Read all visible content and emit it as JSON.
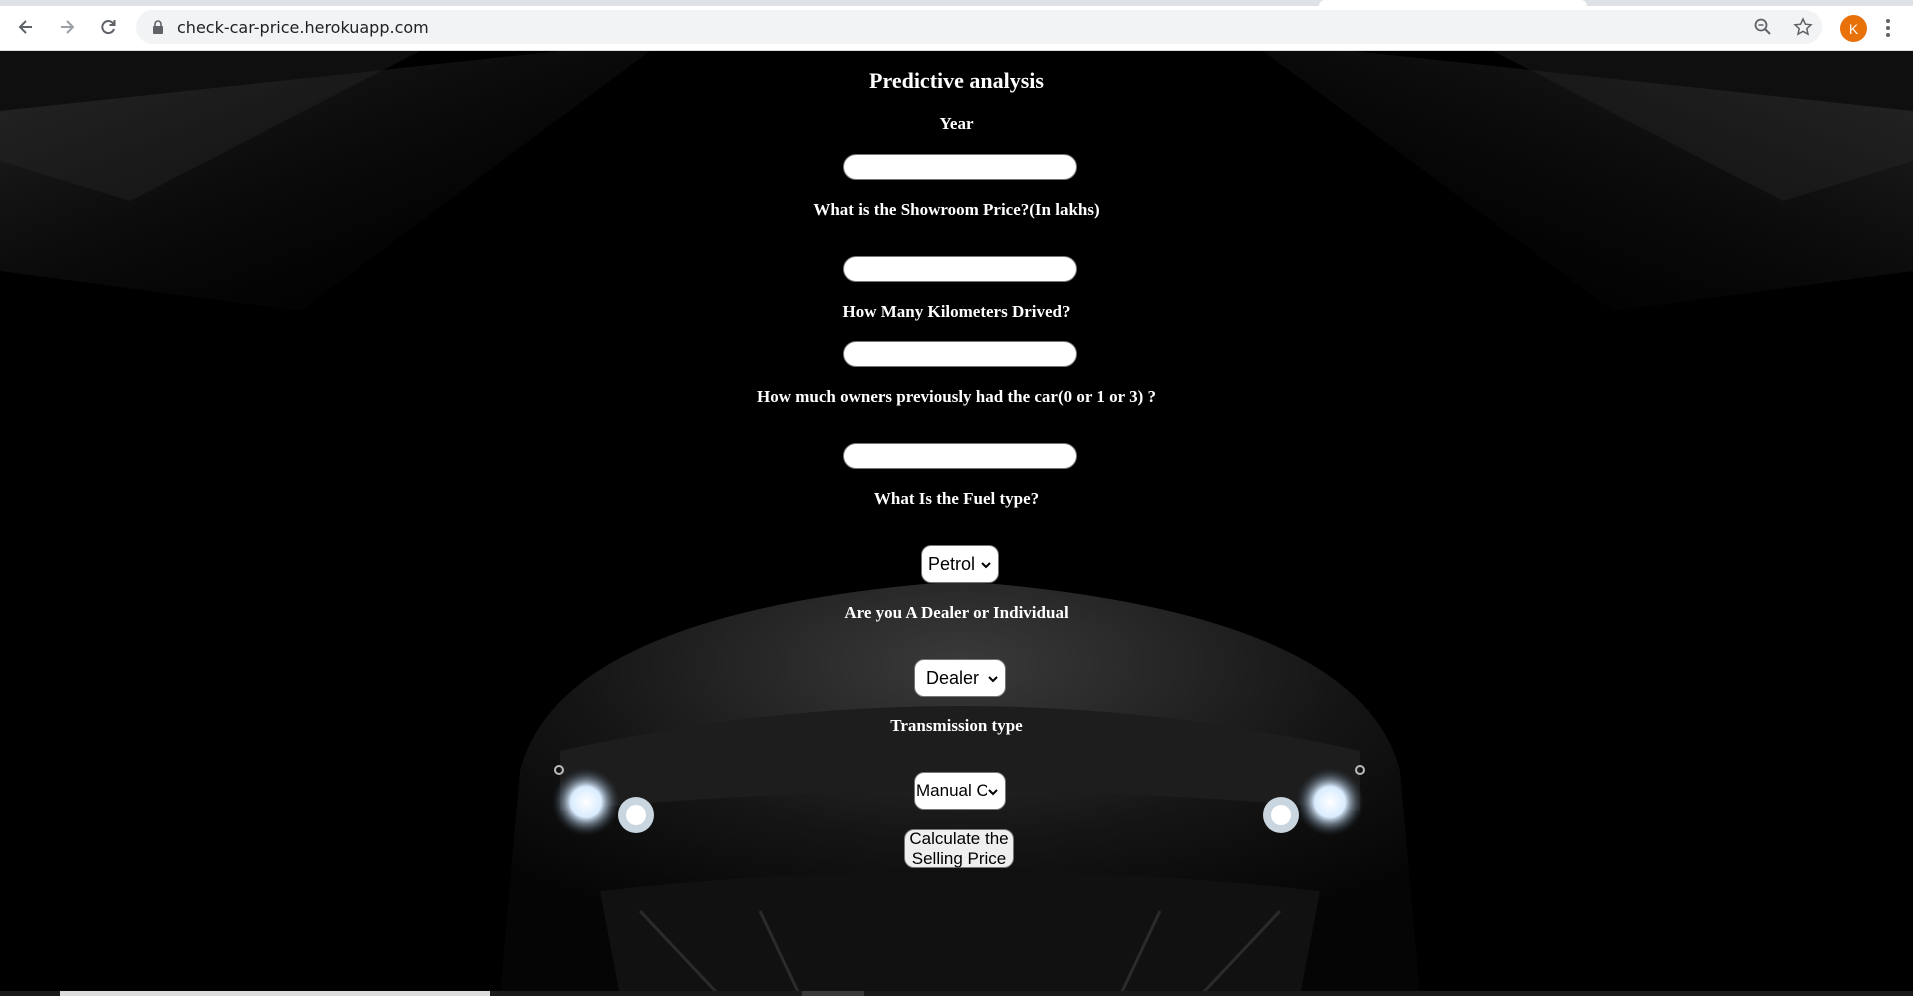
{
  "browser": {
    "url": "check-car-price.herokuapp.com",
    "profile_initial": "K",
    "icons": [
      "back-arrow-icon",
      "forward-arrow-icon",
      "reload-icon",
      "lock-icon",
      "zoom-icon",
      "star-icon",
      "kebab-menu-icon"
    ]
  },
  "form": {
    "title": "Predictive analysis",
    "year_label": "Year",
    "showroom_price_label": "What is the Showroom Price?(In lakhs)",
    "kms_label": "How Many Kilometers Drived?",
    "owners_label": "How much owners previously had the car(0 or 1 or 3) ?",
    "fuel_label": "What Is the Fuel type?",
    "fuel_value": "Petrol",
    "seller_label": "Are you A Dealer or Individual",
    "seller_value": "Dealer",
    "transmission_label": "Transmission type",
    "transmission_value": "Manual Car",
    "submit_label": "Calculate the Selling Price"
  },
  "colors": {
    "background": "#000000",
    "text": "#ffffff",
    "profile_avatar": "#e8710a"
  }
}
